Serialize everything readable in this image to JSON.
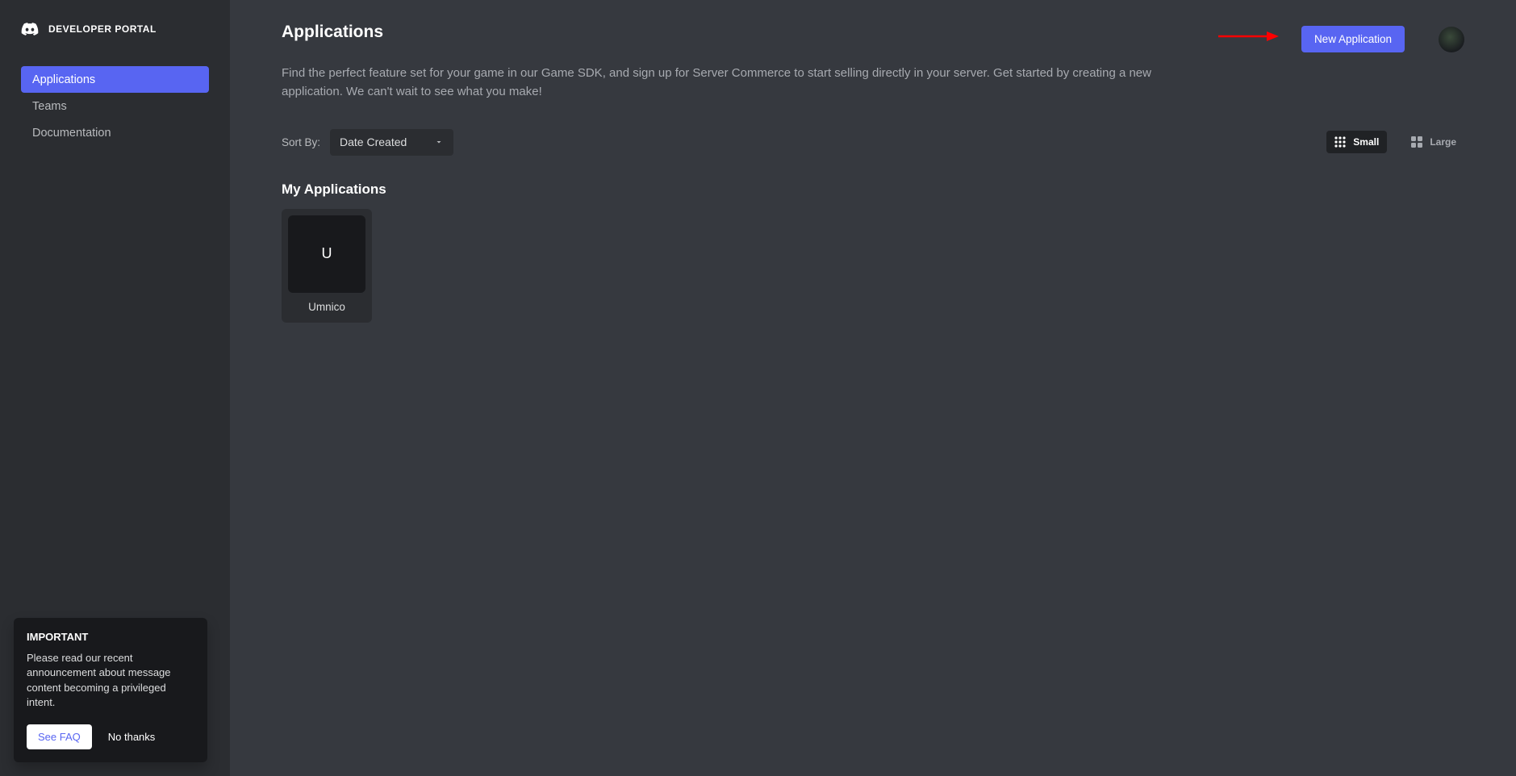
{
  "brand": {
    "portal_title": "DEVELOPER PORTAL"
  },
  "sidebar": {
    "items": [
      {
        "label": "Applications",
        "active": true
      },
      {
        "label": "Teams",
        "active": false
      },
      {
        "label": "Documentation",
        "active": false
      }
    ]
  },
  "notice": {
    "title": "IMPORTANT",
    "body": "Please read our recent announcement about message content becoming a privileged intent.",
    "primary_label": "See FAQ",
    "dismiss_label": "No thanks"
  },
  "header": {
    "title": "Applications",
    "new_app_label": "New Application"
  },
  "page": {
    "description": "Find the perfect feature set for your game in our Game SDK, and sign up for Server Commerce to start selling directly in your server. Get started by creating a new application. We can't wait to see what you make!"
  },
  "toolbar": {
    "sort_label": "Sort By:",
    "sort_value": "Date Created",
    "view_small_label": "Small",
    "view_large_label": "Large",
    "view_active": "small"
  },
  "section": {
    "my_apps_title": "My Applications"
  },
  "apps": [
    {
      "initial": "U",
      "name": "Umnico"
    }
  ],
  "colors": {
    "accent": "#5865f2",
    "bg_main": "#36393f",
    "bg_sidebar": "#2b2d31",
    "bg_dark": "#18191c"
  }
}
